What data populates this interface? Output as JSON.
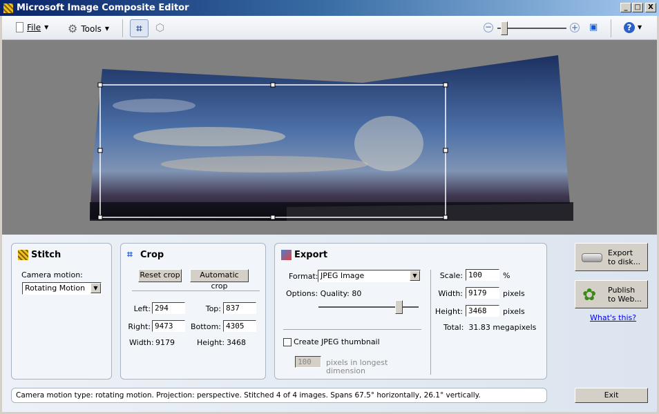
{
  "window": {
    "title": "Microsoft Image Composite Editor",
    "minimize": "_",
    "maximize": "□",
    "close": "X"
  },
  "toolbar": {
    "file": "File",
    "tools": "Tools",
    "active_tool": "crop",
    "zoom_level": 0.05
  },
  "stitch": {
    "title": "Stitch",
    "camera_motion_label": "Camera motion:",
    "camera_motion_value": "Rotating Motion"
  },
  "crop": {
    "title": "Crop",
    "reset": "Reset crop",
    "automatic": "Automatic crop",
    "left_label": "Left:",
    "left": "294",
    "top_label": "Top:",
    "top": "837",
    "right_label": "Right:",
    "right": "9473",
    "bottom_label": "Bottom:",
    "bottom": "4305",
    "width_label": "Width:",
    "width": "9179",
    "height_label": "Height:",
    "height": "3468"
  },
  "export": {
    "title": "Export",
    "format_label": "Format:",
    "format_value": "JPEG Image",
    "options_label": "Options:",
    "quality_label": "Quality:",
    "quality": "80",
    "quality_value": 80,
    "thumbnail_label": "Create JPEG thumbnail",
    "thumbnail_checked": false,
    "thumb_size": "100",
    "thumb_size_label": "pixels in longest",
    "thumb_size_label2": "dimension",
    "scale_label": "Scale:",
    "scale": "100",
    "scale_unit": "%",
    "width_label": "Width:",
    "width": "9179",
    "height_label": "Height:",
    "height": "3468",
    "unit": "pixels",
    "total_label": "Total:",
    "total": "31.83 megapixels"
  },
  "actions": {
    "export_disk_1": "Export",
    "export_disk_2": "to disk...",
    "publish_1": "Publish",
    "publish_2": "to Web...",
    "whats_this": "What's this?",
    "exit": "Exit"
  },
  "status": "Camera motion type: rotating motion. Projection: perspective. Stitched 4 of 4 images. Spans 67.5°   horizontally, 26.1°   vertically."
}
